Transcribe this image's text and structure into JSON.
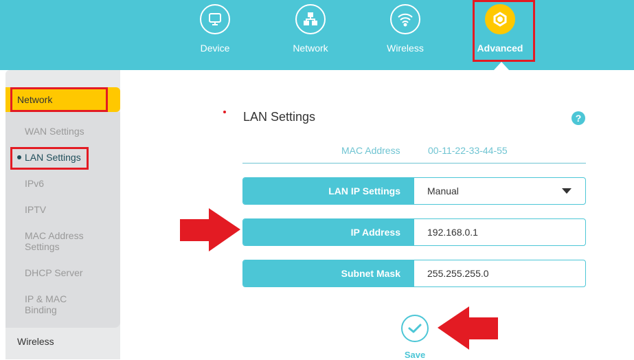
{
  "header": {
    "tabs": [
      {
        "label": "Device",
        "icon": "monitor-icon"
      },
      {
        "label": "Network",
        "icon": "network-topology-icon"
      },
      {
        "label": "Wireless",
        "icon": "wifi-icon"
      },
      {
        "label": "Advanced",
        "icon": "gear-icon",
        "active": true
      }
    ]
  },
  "sidebar": {
    "section": "Network",
    "items": [
      "WAN Settings",
      "LAN Settings",
      "IPv6",
      "IPTV",
      "MAC Address Settings",
      "DHCP Server",
      "IP & MAC Binding"
    ],
    "active": "LAN Settings",
    "next_section": "Wireless"
  },
  "main": {
    "title": "LAN Settings",
    "help": "?",
    "mac_label": "MAC Address",
    "mac_value": "00-11-22-33-44-55",
    "fields": [
      {
        "label": "LAN IP Settings",
        "value": "Manual"
      },
      {
        "label": "IP Address",
        "value": "192.168.0.1"
      },
      {
        "label": "Subnet Mask",
        "value": "255.255.255.0"
      }
    ],
    "save_label": "Save"
  },
  "colors": {
    "accent": "#4cc6d6",
    "highlight": "#ffc800",
    "annotation": "#e31b23"
  }
}
